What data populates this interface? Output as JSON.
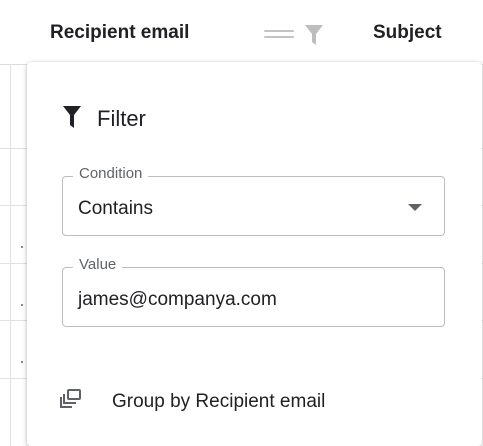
{
  "table": {
    "columns": [
      "Recipient email",
      "Subject"
    ]
  },
  "filter_popup": {
    "title": "Filter",
    "condition": {
      "label": "Condition",
      "value": "Contains"
    },
    "value_field": {
      "label": "Value",
      "value": "james@companya.com"
    },
    "group_by_label": "Group by Recipient email"
  },
  "icons": {
    "header_filter": "filter-funnel-icon",
    "title_filter": "filter-funnel-icon",
    "drag": "drag-handle-icon",
    "dropdown": "arrow-drop-down-icon",
    "group": "group-by-icon"
  },
  "colors": {
    "text": "#202124",
    "muted": "#5f6368",
    "inactive_icon": "#bdbdbd",
    "border": "#bdbdbd"
  }
}
